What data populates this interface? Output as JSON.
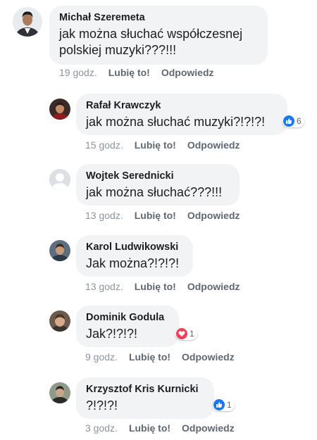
{
  "comments": [
    {
      "author": "Michał Szeremeta",
      "text_lines": [
        "jak można słuchać współczesnej",
        "polskiej muzyki???!!!"
      ],
      "time": "19 godz.",
      "like_label": "Lubię to!",
      "reply_label": "Odpowiedz",
      "reaction": null
    },
    {
      "author": "Rafał Krawczyk",
      "text_lines": [
        "jak można słuchać muzyki?!?!?!"
      ],
      "time": "15 godz.",
      "like_label": "Lubię to!",
      "reply_label": "Odpowiedz",
      "reaction": {
        "type": "like",
        "count": "6"
      }
    },
    {
      "author": "Wojtek Serednicki",
      "text_lines": [
        "jak można słuchać???!!!"
      ],
      "time": "13 godz.",
      "like_label": "Lubię to!",
      "reply_label": "Odpowiedz",
      "reaction": null
    },
    {
      "author": "Karol Ludwikowski",
      "text_lines": [
        "Jak można?!?!?!"
      ],
      "time": "13 godz.",
      "like_label": "Lubię to!",
      "reply_label": "Odpowiedz",
      "reaction": null
    },
    {
      "author": "Dominik Godula",
      "text_lines": [
        "Jak?!?!?!"
      ],
      "time": "9 godz.",
      "like_label": "Lubię to!",
      "reply_label": "Odpowiedz",
      "reaction": {
        "type": "love",
        "count": "1"
      }
    },
    {
      "author": "Krzysztof Kris Kurnicki",
      "text_lines": [
        "?!?!?!"
      ],
      "time": "3 godz.",
      "like_label": "Lubię to!",
      "reply_label": "Odpowiedz",
      "reaction": {
        "type": "like",
        "count": "1"
      }
    }
  ],
  "colors": {
    "bubble": "#f2f3f5",
    "like": "#1877f2",
    "love": "#f33e58",
    "meta_text": "#606770"
  },
  "icons": {
    "like_reaction": "thumbs-up-icon",
    "love_reaction": "heart-icon"
  }
}
